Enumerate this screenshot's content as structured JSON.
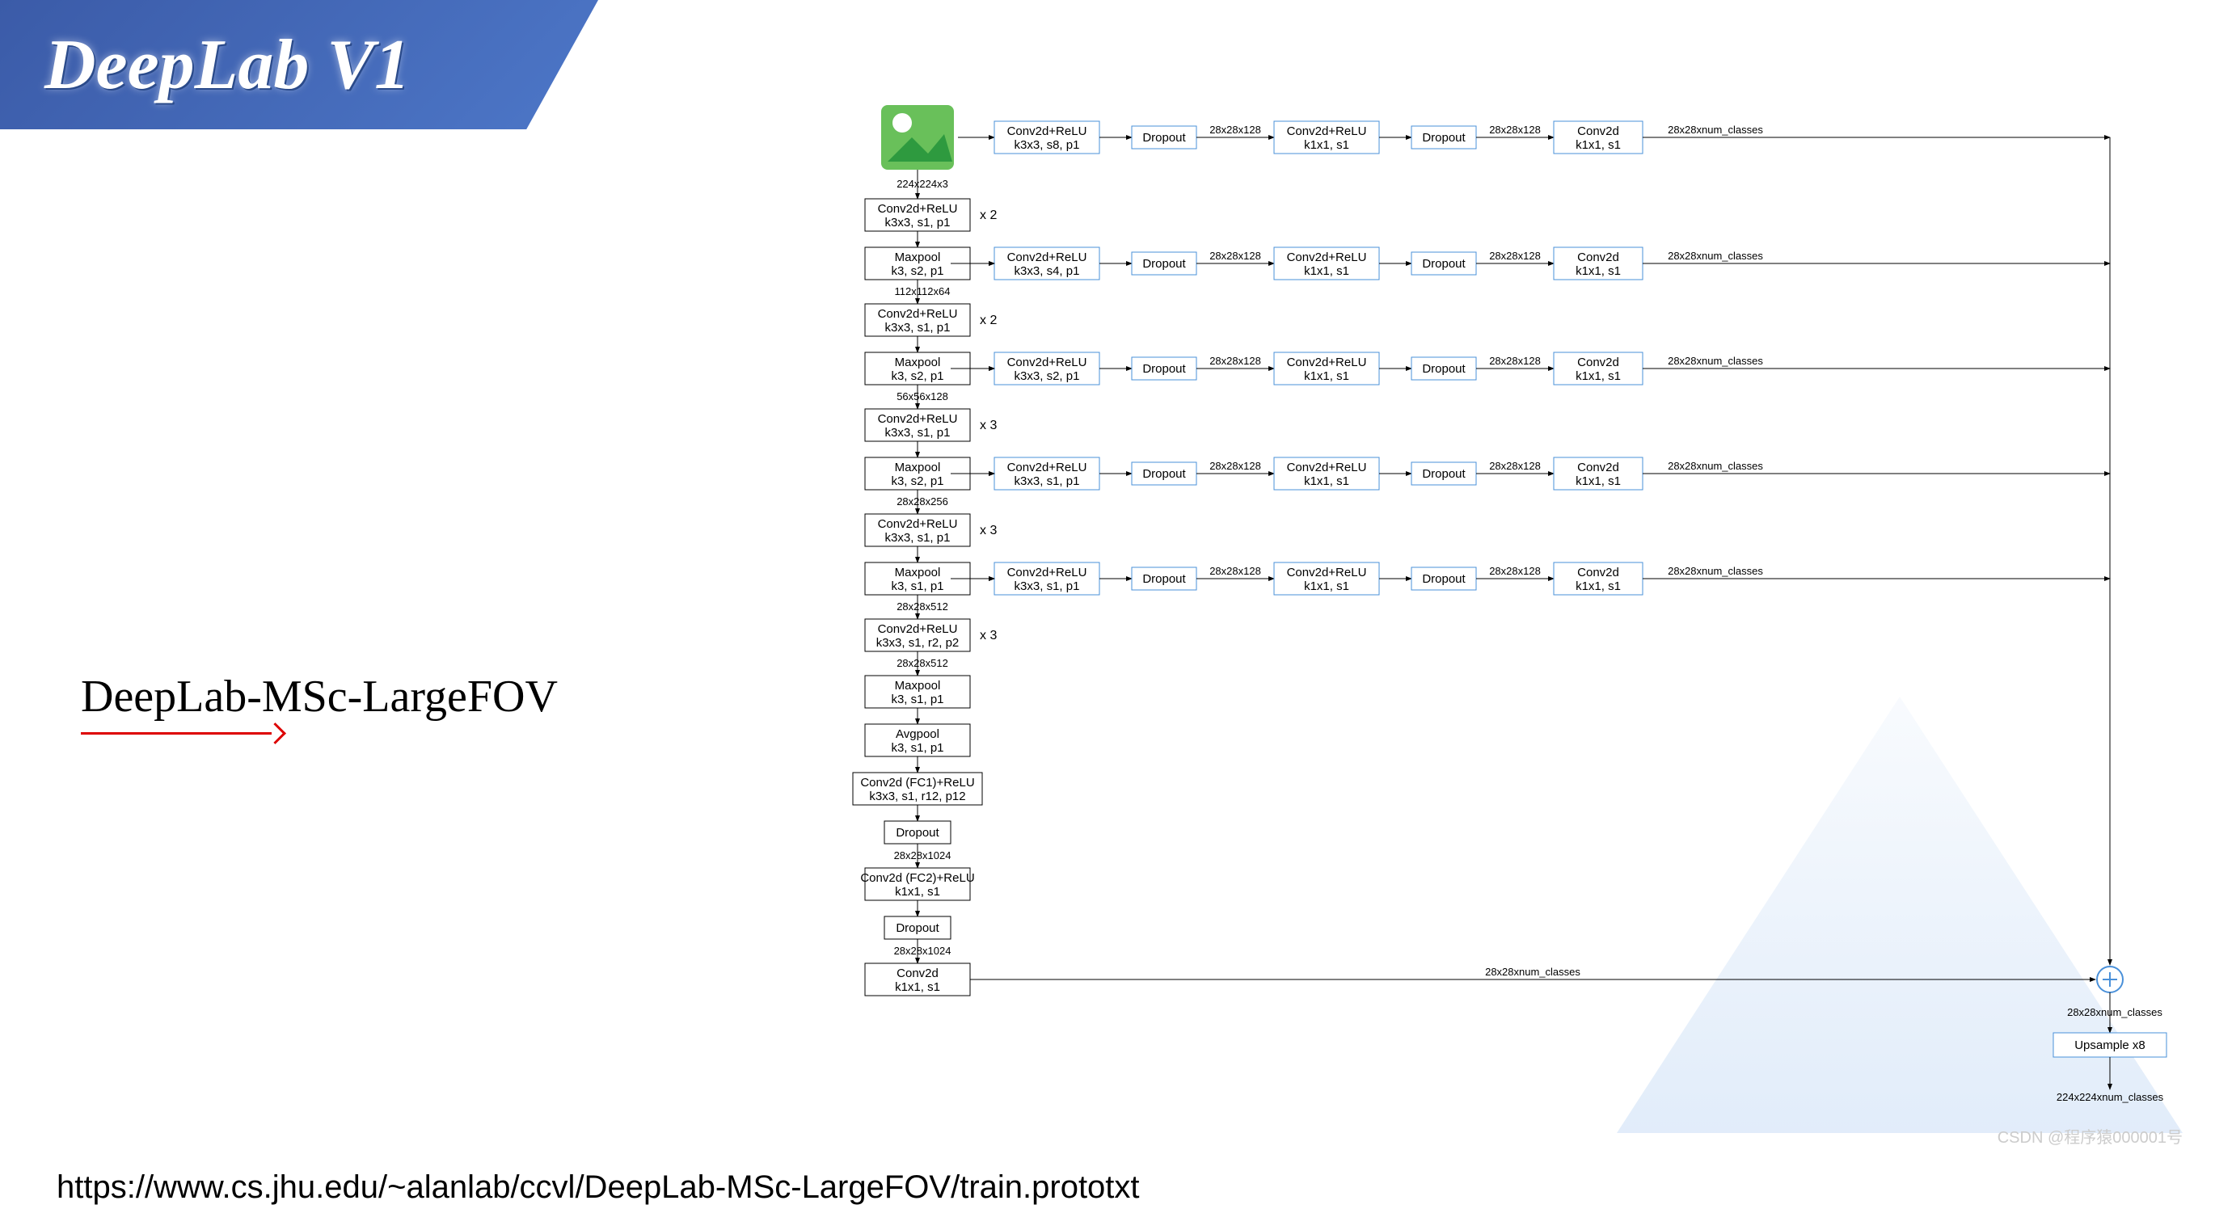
{
  "banner": {
    "title": "DeepLab V1"
  },
  "subtitle": "DeepLab-MSc-LargeFOV",
  "footer_url": "https://www.cs.jhu.edu/~alanlab/ccvl/DeepLab-MSc-LargeFOV/train.prototxt",
  "footer_watermark": "CSDN @程序猿000001号",
  "chart_data": {
    "type": "diagram",
    "description": "Network architecture of DeepLab-MSc-LargeFOV (multi-scale). A backbone column of VGG-like Conv+ReLU / Maxpool blocks with annotated tensor sizes; from five intermediate points extra heads (Conv→Dropout→Conv→Dropout→Conv) produce 28x28xnum_classes maps that are element-wise summed with the main head, then Upsample x8 to 224x224xnum_classes.",
    "backbone": [
      {
        "id": "input",
        "label": "input image",
        "out": "224x224x3"
      },
      {
        "id": "c1",
        "l1": "Conv2d+ReLU",
        "l2": "k3x3, s1, p1",
        "repeat": "x 2"
      },
      {
        "id": "p1",
        "l1": "Maxpool",
        "l2": "k3, s2, p1",
        "out": "112x112x64"
      },
      {
        "id": "c2",
        "l1": "Conv2d+ReLU",
        "l2": "k3x3, s1, p1",
        "repeat": "x 2"
      },
      {
        "id": "p2",
        "l1": "Maxpool",
        "l2": "k3, s2, p1",
        "out": "56x56x128"
      },
      {
        "id": "c3",
        "l1": "Conv2d+ReLU",
        "l2": "k3x3, s1, p1",
        "repeat": "x 3"
      },
      {
        "id": "p3",
        "l1": "Maxpool",
        "l2": "k3, s2, p1",
        "out": "28x28x256"
      },
      {
        "id": "c4",
        "l1": "Conv2d+ReLU",
        "l2": "k3x3, s1, p1",
        "repeat": "x 3"
      },
      {
        "id": "p4",
        "l1": "Maxpool",
        "l2": "k3, s1, p1",
        "out": "28x28x512"
      },
      {
        "id": "c5",
        "l1": "Conv2d+ReLU",
        "l2": "k3x3, s1, r2, p2",
        "repeat": "x 3",
        "out": "28x28x512"
      },
      {
        "id": "p5",
        "l1": "Maxpool",
        "l2": "k3, s1, p1"
      },
      {
        "id": "avg",
        "l1": "Avgpool",
        "l2": "k3, s1, p1"
      },
      {
        "id": "fc1",
        "l1": "Conv2d (FC1)+ReLU",
        "l2": "k3x3, s1, r12, p12"
      },
      {
        "id": "d1",
        "l1": "Dropout",
        "out": "28x28x1024"
      },
      {
        "id": "fc2",
        "l1": "Conv2d (FC2)+ReLU",
        "l2": "k1x1, s1"
      },
      {
        "id": "d2",
        "l1": "Dropout",
        "out": "28x28x1024"
      },
      {
        "id": "fc3",
        "l1": "Conv2d",
        "l2": "k1x1, s1",
        "out_right": "28x28xnum_classes"
      }
    ],
    "heads": [
      {
        "from": "input",
        "h1": {
          "l1": "Conv2d+ReLU",
          "l2": "k3x3, s8, p1"
        }
      },
      {
        "from": "p1",
        "h1": {
          "l1": "Conv2d+ReLU",
          "l2": "k3x3, s4, p1"
        }
      },
      {
        "from": "p2",
        "h1": {
          "l1": "Conv2d+ReLU",
          "l2": "k3x3, s2, p1"
        }
      },
      {
        "from": "p3",
        "h1": {
          "l1": "Conv2d+ReLU",
          "l2": "k3x3, s1, p1"
        }
      },
      {
        "from": "p4",
        "h1": {
          "l1": "Conv2d+ReLU",
          "l2": "k3x3, s1, p1"
        }
      }
    ],
    "head_common": {
      "drop": "Dropout",
      "h2": {
        "l1": "Conv2d+ReLU",
        "l2": "k1x1, s1"
      },
      "h3": {
        "l1": "Conv2d",
        "l2": "k1x1, s1"
      },
      "mid_dim": "28x28x128",
      "out_dim": "28x28xnum_classes"
    },
    "sum": {
      "label": "element-wise sum",
      "out": "28x28xnum_classes"
    },
    "upsample": {
      "l1": "Upsample x8",
      "out": "224x224xnum_classes"
    }
  }
}
